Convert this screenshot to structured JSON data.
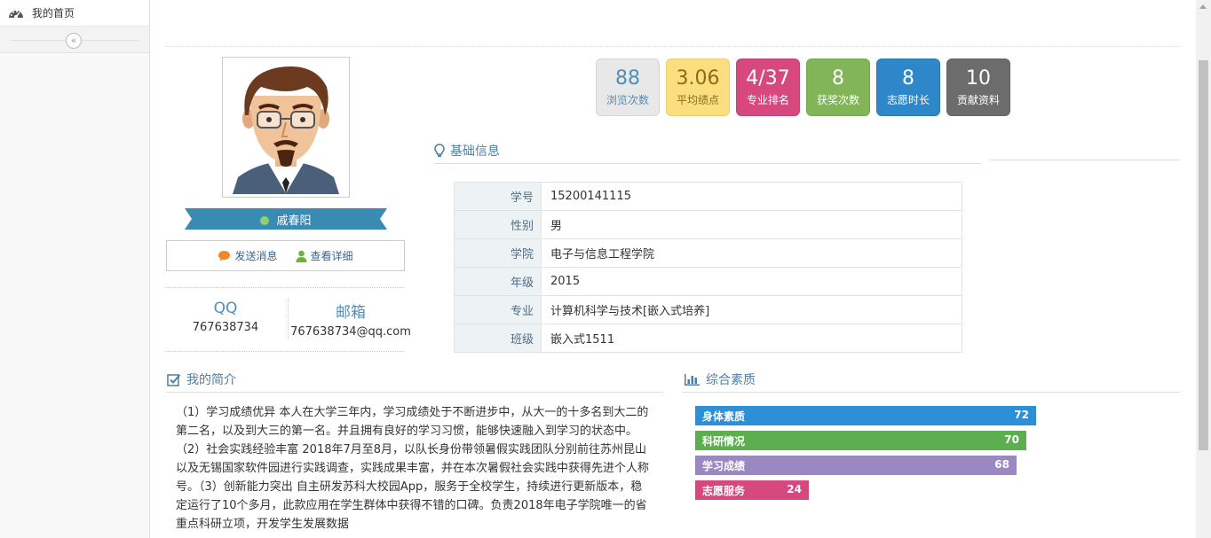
{
  "sidebar": {
    "home_label": "我的首页",
    "home_icon": "dashboard-icon",
    "collapse_glyph": "«"
  },
  "profile": {
    "name": "戚春阳",
    "send_message": "发送消息",
    "view_details": "查看详细",
    "qq_title": "QQ",
    "qq_value": "767638734",
    "email_title": "邮箱",
    "email_value": "767638734@qq.com",
    "online_color": "#8fd16e"
  },
  "stats": [
    {
      "value": "88",
      "label": "浏览次数",
      "bg": "#e8e8e8",
      "fg": "#4f8fc0"
    },
    {
      "value": "3.06",
      "label": "平均绩点",
      "bg": "#fbdf7e",
      "fg": "#8a6d1b"
    },
    {
      "value": "4/37",
      "label": "专业排名",
      "bg": "#d6487e",
      "fg": "#ffffff"
    },
    {
      "value": "8",
      "label": "获奖次数",
      "bg": "#82b558",
      "fg": "#ffffff"
    },
    {
      "value": "8",
      "label": "志愿时长",
      "bg": "#2d87c9",
      "fg": "#ffffff"
    },
    {
      "value": "10",
      "label": "贡献资料",
      "bg": "#6c6c6c",
      "fg": "#ffffff"
    }
  ],
  "basic_info": {
    "title": "基础信息",
    "rows": [
      {
        "key": "学号",
        "value": "15200141115"
      },
      {
        "key": "性别",
        "value": "男"
      },
      {
        "key": "学院",
        "value": "电子与信息工程学院"
      },
      {
        "key": "年级",
        "value": "2015"
      },
      {
        "key": "专业",
        "value": "计算机科学与技术[嵌入式培养]"
      },
      {
        "key": "班级",
        "value": "嵌入式1511"
      }
    ]
  },
  "intro": {
    "title": "我的简介",
    "text": "（1）学习成绩优异 本人在大学三年内，学习成绩处于不断进步中，从大一的十多名到大二的第二名，以及到大三的第一名。并且拥有良好的学习习惯，能够快速融入到学习的状态中。（2）社会实践经验丰富 2018年7月至8月，以队长身份带领暑假实践团队分别前往苏州昆山以及无锡国家软件园进行实践调查，实践成果丰富，并在本次暑假社会实践中获得先进个人称号。（3）创新能力突出 自主研发苏科大校园App，服务于全校学生，持续进行更新版本，稳定运行了10个多月，此款应用在学生群体中获得不错的口碑。负责2018年电子学院唯一的省重点科研立项，开发学生发展数据"
  },
  "quality": {
    "title": "综合素质",
    "max": 100,
    "items": [
      {
        "label": "身体素质",
        "value": 72,
        "color": "#2d8fd6"
      },
      {
        "label": "科研情况",
        "value": 70,
        "color": "#5cae4f"
      },
      {
        "label": "学习成绩",
        "value": 68,
        "color": "#9b88c3"
      },
      {
        "label": "志愿服务",
        "value": 24,
        "color": "#d6487e"
      }
    ]
  }
}
